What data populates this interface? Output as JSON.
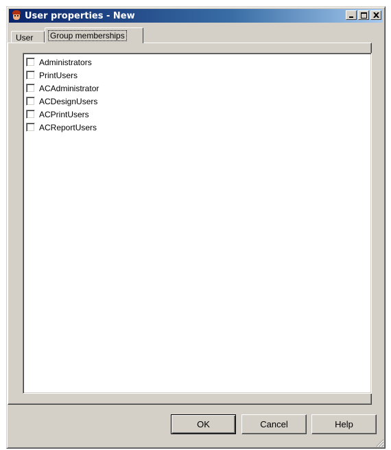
{
  "window": {
    "title": "User properties - New"
  },
  "tabs": [
    {
      "label": "User",
      "active": false
    },
    {
      "label": "Group memberships",
      "active": true
    }
  ],
  "group_list": {
    "items": [
      {
        "label": "Administrators",
        "checked": false
      },
      {
        "label": "PrintUsers",
        "checked": false
      },
      {
        "label": "ACAdministrator",
        "checked": false
      },
      {
        "label": "ACDesignUsers",
        "checked": false
      },
      {
        "label": "ACPrintUsers",
        "checked": false
      },
      {
        "label": "ACReportUsers",
        "checked": false
      }
    ]
  },
  "buttons": {
    "ok": "OK",
    "cancel": "Cancel",
    "help": "Help"
  },
  "colors": {
    "title_bar_start": "#0a246a",
    "title_bar_end": "#a6caf0",
    "dialog_face": "#d4d0c8"
  }
}
